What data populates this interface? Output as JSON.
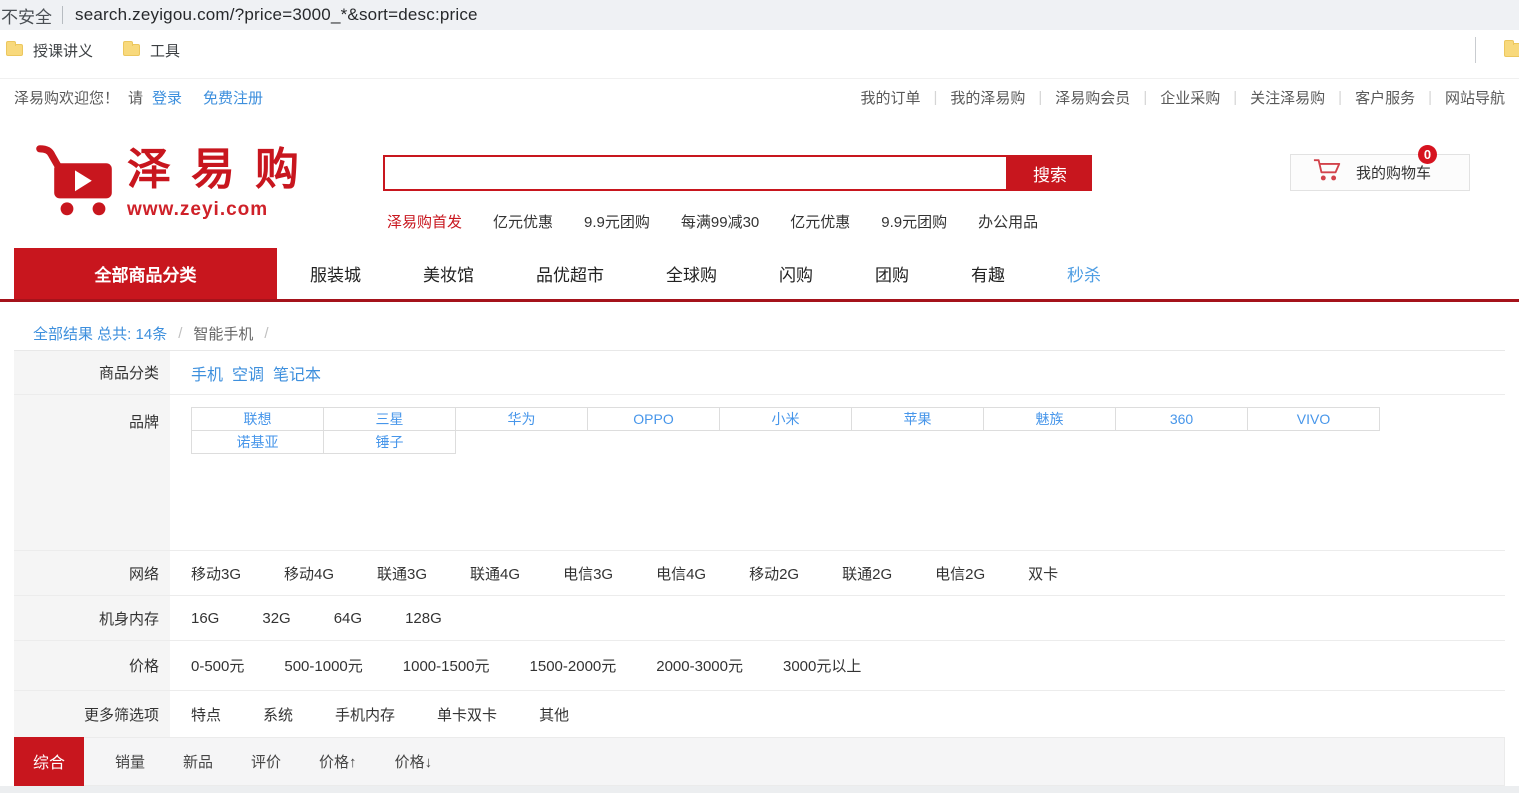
{
  "colors": {
    "primary_red": "#c8161e",
    "link_blue": "#3d8fdd",
    "badge_red": "#d6131f",
    "nav_active_blue": "#4d9de3"
  },
  "browser": {
    "security_label": "不安全",
    "url": "search.zeyigou.com/?price=3000_*&sort=desc:price",
    "bookmarks": [
      "授课讲义",
      "工具"
    ]
  },
  "topbar": {
    "welcome": "泽易购欢迎您！",
    "please": "请",
    "login": "登录",
    "register": "免费注册",
    "links": [
      "我的订单",
      "我的泽易购",
      "泽易购会员",
      "企业采购",
      "关注泽易购",
      "客户服务",
      "网站导航"
    ]
  },
  "header": {
    "logo_title": "泽易购",
    "logo_site": "www.zeyi.com",
    "search_value": "",
    "search_button": "搜索",
    "hot_links": [
      "泽易购首发",
      "亿元优惠",
      "9.9元团购",
      "每满99减30",
      "亿元优惠",
      "9.9元团购",
      "办公用品"
    ],
    "cart_label": "我的购物车",
    "cart_count": "0"
  },
  "nav": {
    "all_categories": "全部商品分类",
    "items": [
      "服装城",
      "美妆馆",
      "品优超市",
      "全球购",
      "闪购",
      "团购",
      "有趣",
      "秒杀"
    ]
  },
  "breadcrumb": {
    "results": "全部结果 总共: 14条",
    "sep1": "/",
    "category": "智能手机",
    "sep2": "/"
  },
  "filters": {
    "category": {
      "label": "商品分类",
      "links": [
        "手机",
        "空调",
        "笔记本"
      ]
    },
    "brand": {
      "label": "品牌",
      "items": [
        "联想",
        "三星",
        "华为",
        "OPPO",
        "小米",
        "苹果",
        "魅族",
        "360",
        "VIVO",
        "诺基亚",
        "锤子"
      ]
    },
    "network": {
      "label": "网络",
      "options": [
        "移动3G",
        "移动4G",
        "联通3G",
        "联通4G",
        "电信3G",
        "电信4G",
        "移动2G",
        "联通2G",
        "电信2G",
        "双卡"
      ]
    },
    "memory": {
      "label": "机身内存",
      "options": [
        "16G",
        "32G",
        "64G",
        "128G"
      ]
    },
    "price": {
      "label": "价格",
      "options": [
        "0-500元",
        "500-1000元",
        "1000-1500元",
        "1500-2000元",
        "2000-3000元",
        "3000元以上"
      ]
    },
    "more": {
      "label": "更多筛选项",
      "options": [
        "特点",
        "系统",
        "手机内存",
        "单卡双卡",
        "其他"
      ]
    }
  },
  "sort": {
    "active": "综合",
    "items": [
      "销量",
      "新品",
      "评价",
      "价格↑",
      "价格↓"
    ]
  }
}
